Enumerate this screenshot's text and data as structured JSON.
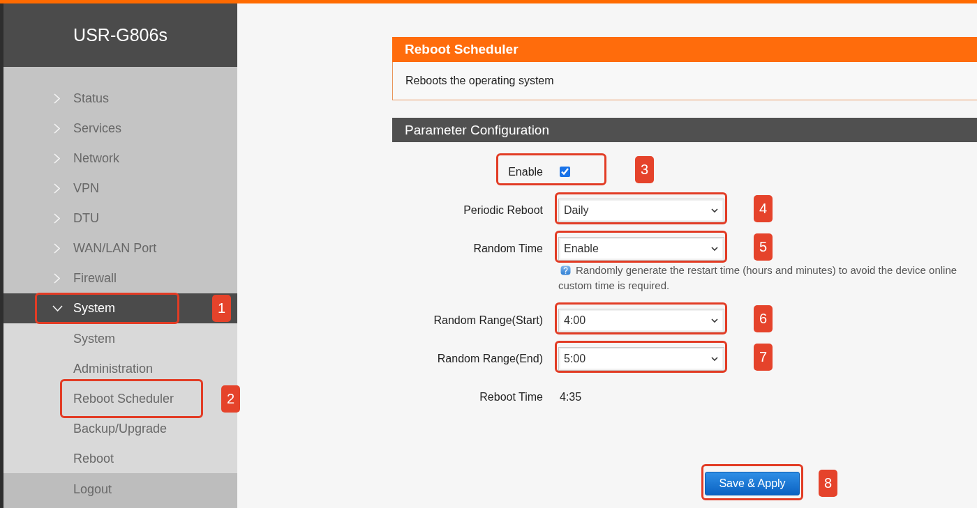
{
  "sidebar": {
    "brand": "USR-G806s",
    "items": [
      {
        "label": "Status",
        "expanded": false
      },
      {
        "label": "Services",
        "expanded": false
      },
      {
        "label": "Network",
        "expanded": false
      },
      {
        "label": "VPN",
        "expanded": false
      },
      {
        "label": "DTU",
        "expanded": false
      },
      {
        "label": "WAN/LAN Port",
        "expanded": false
      },
      {
        "label": "Firewall",
        "expanded": false
      },
      {
        "label": "System",
        "expanded": true,
        "callout": "1",
        "children": [
          {
            "label": "System"
          },
          {
            "label": "Administration"
          },
          {
            "label": "Reboot Scheduler",
            "callout": "2"
          },
          {
            "label": "Backup/Upgrade"
          },
          {
            "label": "Reboot"
          }
        ]
      }
    ],
    "logout": "Logout"
  },
  "panel": {
    "title": "Reboot Scheduler",
    "description": "Reboots the operating system"
  },
  "config": {
    "title": "Parameter Configuration",
    "fields": [
      {
        "kind": "checkbox",
        "label": "Enable",
        "checked": true,
        "callout": "3"
      },
      {
        "kind": "select",
        "label": "Periodic Reboot",
        "value": "Daily",
        "callout": "4"
      },
      {
        "kind": "select",
        "label": "Random Time",
        "value": "Enable",
        "callout": "5",
        "help": [
          "Randomly generate the restart time (hours and minutes) to avoid the device online",
          "custom time is required."
        ]
      },
      {
        "kind": "select",
        "label": "Random Range(Start)",
        "value": "4:00",
        "callout": "6"
      },
      {
        "kind": "select",
        "label": "Random Range(End)",
        "value": "5:00",
        "callout": "7"
      },
      {
        "kind": "text",
        "label": "Reboot Time",
        "value": "4:35"
      }
    ]
  },
  "save_button": {
    "label": "Save & Apply",
    "callout": "8"
  }
}
